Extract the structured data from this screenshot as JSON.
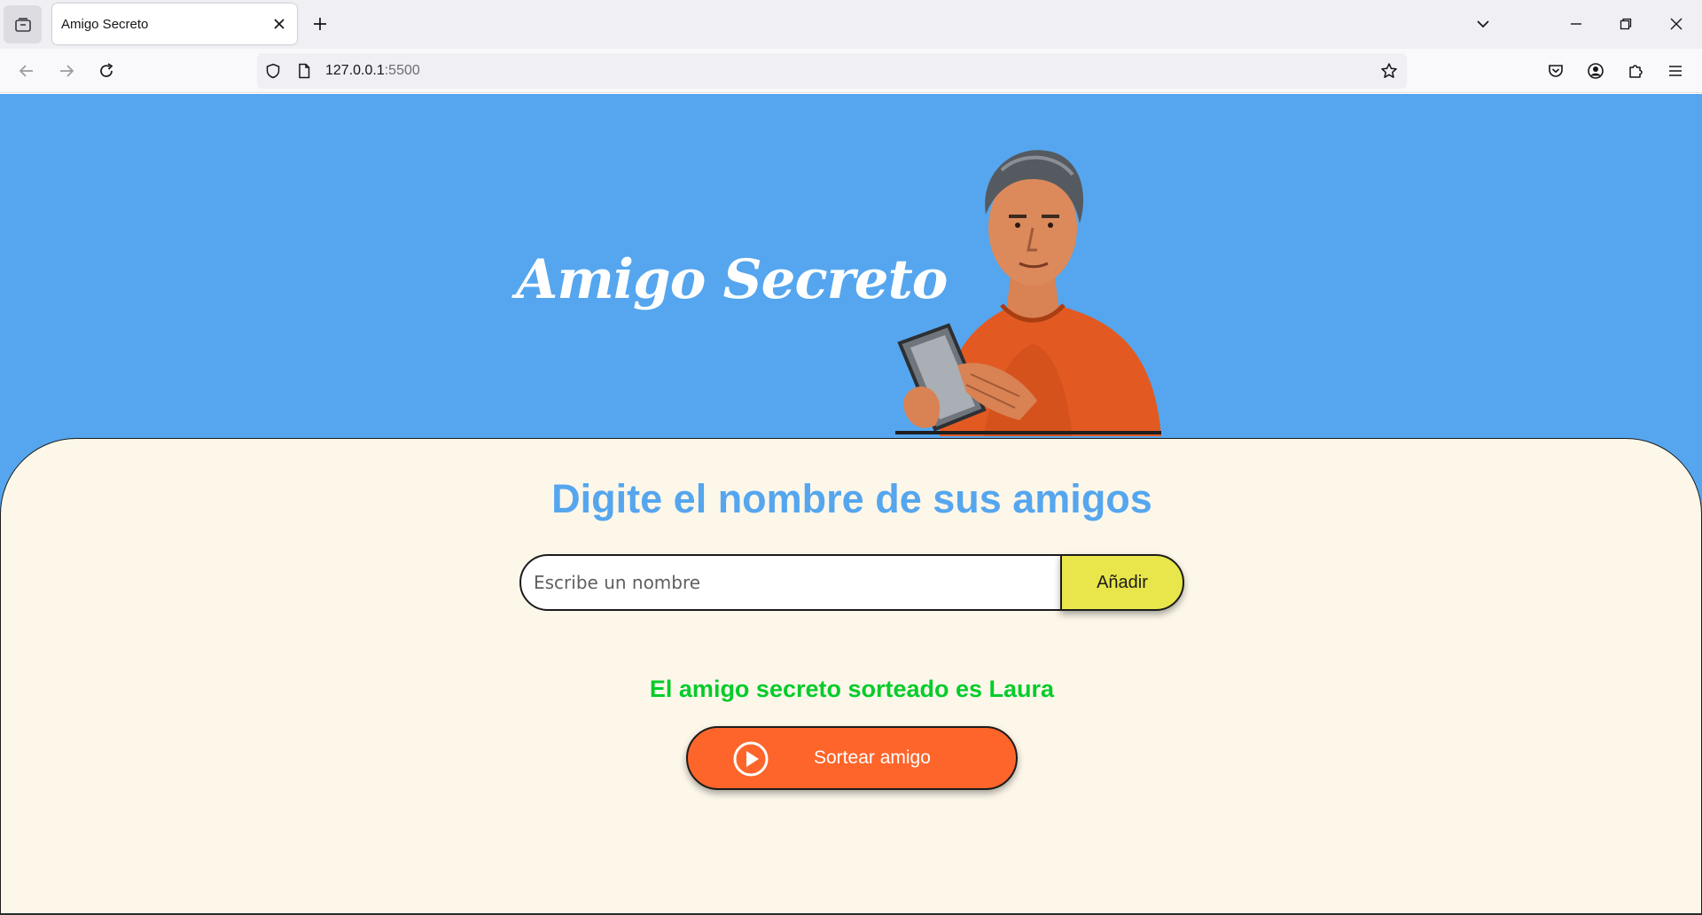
{
  "browser": {
    "tab_title": "Amigo Secreto",
    "url_host": "127.0.0.1",
    "url_port": ":5500"
  },
  "page": {
    "header_title": "Amigo Secreto",
    "hero_image": "man-with-tablet-illustration",
    "subtitle": "Digite el nombre de sus amigos",
    "input_placeholder": "Escribe un nombre",
    "add_button": "Añadir",
    "result_text": "El amigo secreto sorteado es Laura",
    "draw_button": "Sortear amigo",
    "draw_icon": "play-circle-icon"
  },
  "colors": {
    "header_bg": "#55a6ee",
    "card_bg": "#fdf7ea",
    "subtitle": "#55a6ee",
    "add_button": "#e8e64a",
    "draw_button": "#fe652b",
    "result": "#05cc2a"
  }
}
